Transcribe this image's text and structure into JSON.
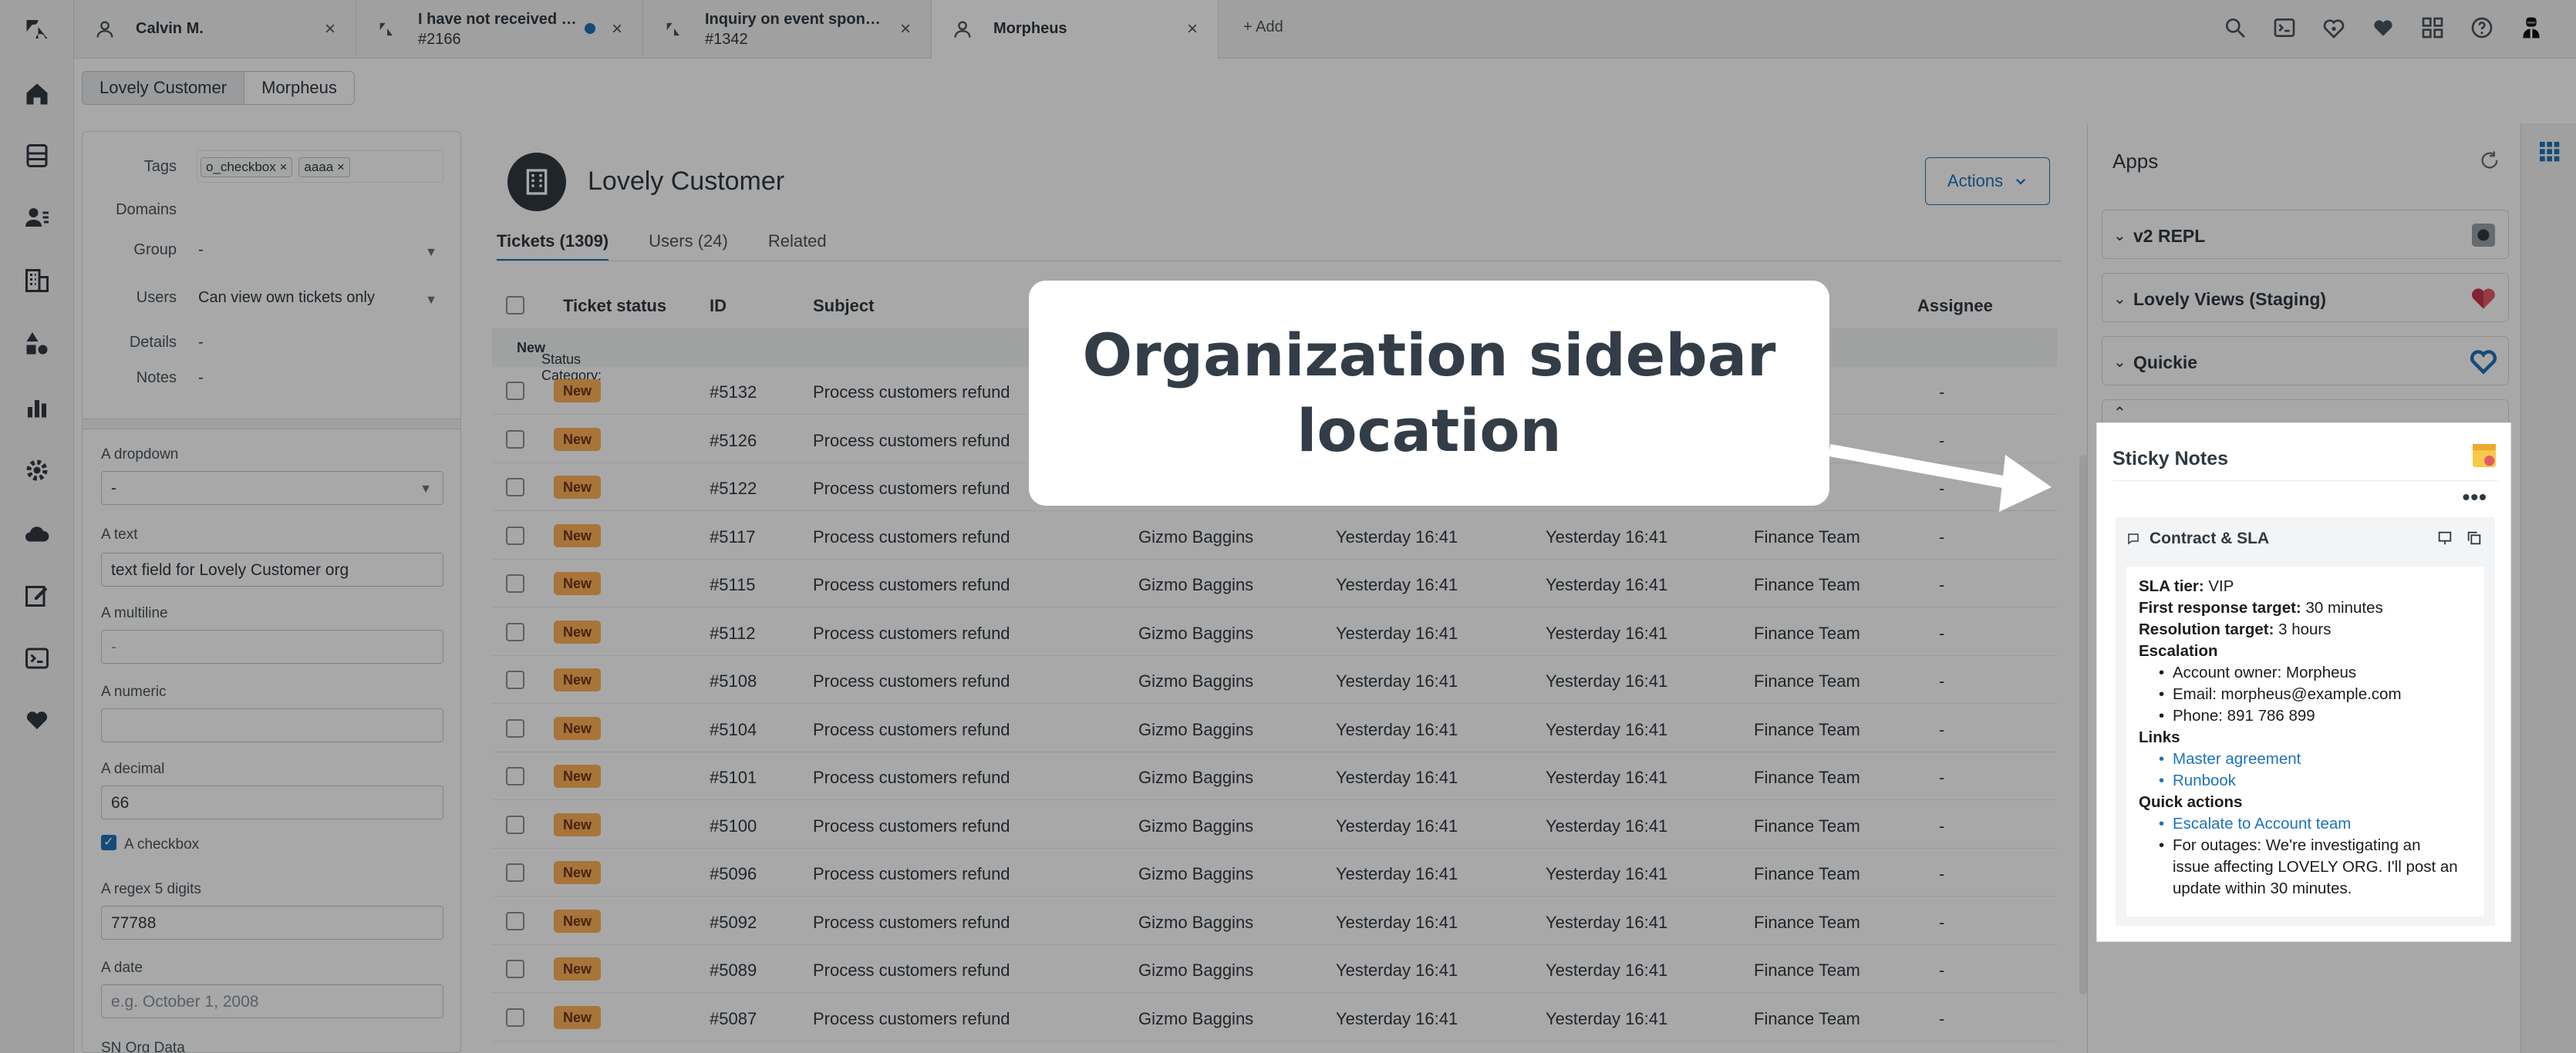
{
  "topbar": {
    "tabs": [
      {
        "title": "Calvin M.",
        "sub": "",
        "icon": "user-icon"
      },
      {
        "title": "I have not received …",
        "sub": "#2166",
        "icon": "ticket-icon"
      },
      {
        "title": "Inquiry on event spon…",
        "sub": "#1342",
        "icon": "ticket-icon"
      },
      {
        "title": "Morpheus",
        "sub": "",
        "icon": "user-icon"
      }
    ],
    "add_label": "+ Add",
    "close_glyph": "×"
  },
  "breadcrumb": {
    "org": "Lovely Customer",
    "user": "Morpheus"
  },
  "org_fields": {
    "tags_label": "Tags",
    "tags": [
      "o_checkbox ×",
      "aaaa ×"
    ],
    "domains_label": "Domains",
    "group_label": "Group",
    "group_value": "-",
    "users_label": "Users",
    "users_value": "Can view own tickets only",
    "details_label": "Details",
    "details_value": "-",
    "notes_label": "Notes",
    "notes_value": "-"
  },
  "custom_fields": {
    "dropdown_label": "A dropdown",
    "dropdown_value": "-",
    "text_label": "A text",
    "text_value": "text field for Lovely Customer org",
    "multiline_label": "A multiline",
    "multiline_value": "-",
    "numeric_label": "A numeric",
    "numeric_value": "",
    "decimal_label": "A decimal",
    "decimal_value": "66",
    "checkbox_label": "A checkbox",
    "regex_label": "A regex 5 digits",
    "regex_value": "77788",
    "date_label": "A date",
    "date_placeholder": "e.g. October 1, 2008",
    "sn_label": "SN Org Data"
  },
  "main": {
    "org_name": "Lovely Customer",
    "actions_label": "Actions",
    "subtabs": [
      "Tickets (1309)",
      "Users (24)",
      "Related"
    ],
    "columns": {
      "status": "Ticket status",
      "id": "ID",
      "subject": "Subject",
      "assignee": "Assignee"
    },
    "group_prefix": "Status Category:",
    "group_name": "New",
    "rows": [
      {
        "status": "New",
        "id": "#5132",
        "subject": "Process customers refund",
        "requester": "",
        "requested": "",
        "updated": "",
        "group": "Team",
        "assignee": "-"
      },
      {
        "status": "New",
        "id": "#5126",
        "subject": "Process customers refund",
        "requester": "",
        "requested": "",
        "updated": "",
        "group": "Team",
        "assignee": "-"
      },
      {
        "status": "New",
        "id": "#5122",
        "subject": "Process customers refund",
        "requester": "",
        "requested": "",
        "updated": "",
        "group": "Team",
        "assignee": "-"
      },
      {
        "status": "New",
        "id": "#5117",
        "subject": "Process customers refund",
        "requester": "Gizmo Baggins",
        "requested": "Yesterday 16:41",
        "updated": "Yesterday 16:41",
        "group": "Finance Team",
        "assignee": "-"
      },
      {
        "status": "New",
        "id": "#5115",
        "subject": "Process customers refund",
        "requester": "Gizmo Baggins",
        "requested": "Yesterday 16:41",
        "updated": "Yesterday 16:41",
        "group": "Finance Team",
        "assignee": "-"
      },
      {
        "status": "New",
        "id": "#5112",
        "subject": "Process customers refund",
        "requester": "Gizmo Baggins",
        "requested": "Yesterday 16:41",
        "updated": "Yesterday 16:41",
        "group": "Finance Team",
        "assignee": "-"
      },
      {
        "status": "New",
        "id": "#5108",
        "subject": "Process customers refund",
        "requester": "Gizmo Baggins",
        "requested": "Yesterday 16:41",
        "updated": "Yesterday 16:41",
        "group": "Finance Team",
        "assignee": "-"
      },
      {
        "status": "New",
        "id": "#5104",
        "subject": "Process customers refund",
        "requester": "Gizmo Baggins",
        "requested": "Yesterday 16:41",
        "updated": "Yesterday 16:41",
        "group": "Finance Team",
        "assignee": "-"
      },
      {
        "status": "New",
        "id": "#5101",
        "subject": "Process customers refund",
        "requester": "Gizmo Baggins",
        "requested": "Yesterday 16:41",
        "updated": "Yesterday 16:41",
        "group": "Finance Team",
        "assignee": "-"
      },
      {
        "status": "New",
        "id": "#5100",
        "subject": "Process customers refund",
        "requester": "Gizmo Baggins",
        "requested": "Yesterday 16:41",
        "updated": "Yesterday 16:41",
        "group": "Finance Team",
        "assignee": "-"
      },
      {
        "status": "New",
        "id": "#5096",
        "subject": "Process customers refund",
        "requester": "Gizmo Baggins",
        "requested": "Yesterday 16:41",
        "updated": "Yesterday 16:41",
        "group": "Finance Team",
        "assignee": "-"
      },
      {
        "status": "New",
        "id": "#5092",
        "subject": "Process customers refund",
        "requester": "Gizmo Baggins",
        "requested": "Yesterday 16:41",
        "updated": "Yesterday 16:41",
        "group": "Finance Team",
        "assignee": "-"
      },
      {
        "status": "New",
        "id": "#5089",
        "subject": "Process customers refund",
        "requester": "Gizmo Baggins",
        "requested": "Yesterday 16:41",
        "updated": "Yesterday 16:41",
        "group": "Finance Team",
        "assignee": "-"
      },
      {
        "status": "New",
        "id": "#5087",
        "subject": "Process customers refund",
        "requester": "Gizmo Baggins",
        "requested": "Yesterday 16:41",
        "updated": "Yesterday 16:41",
        "group": "Finance Team",
        "assignee": "-"
      }
    ]
  },
  "apps": {
    "title": "Apps",
    "items": [
      {
        "name": "v2 REPL",
        "icon": "repl-logo-icon"
      },
      {
        "name": "Lovely Views (Staging)",
        "icon": "heart-logo-icon"
      },
      {
        "name": "Quickie",
        "icon": "quickie-logo-icon"
      }
    ]
  },
  "sticky": {
    "title": "Sticky Notes",
    "more": "•••",
    "note_title": "Contract & SLA",
    "sla_tier_label": "SLA tier:",
    "sla_tier_value": "VIP",
    "first_response_label": "First response target:",
    "first_response_value": "30 minutes",
    "resolution_label": "Resolution target:",
    "resolution_value": "3 hours",
    "escalation_heading": "Escalation",
    "escalation_items": [
      "Account owner: Morpheus",
      "Email: morpheus@example.com",
      "Phone: 891 786 899"
    ],
    "links_heading": "Links",
    "links": [
      "Master agreement",
      "Runbook"
    ],
    "quick_heading": "Quick actions",
    "quick_link": "Escalate to Account team",
    "quick_lines": [
      "For outages: We're investigating an",
      "issue affecting LOVELY ORG. I'll post an",
      "update within 30 minutes."
    ]
  },
  "callout": {
    "line1": "Organization sidebar",
    "line2": "location"
  },
  "colors": {
    "accent": "#1f73b7",
    "badge_new": "#ffb057",
    "dark": "#2f3941"
  }
}
